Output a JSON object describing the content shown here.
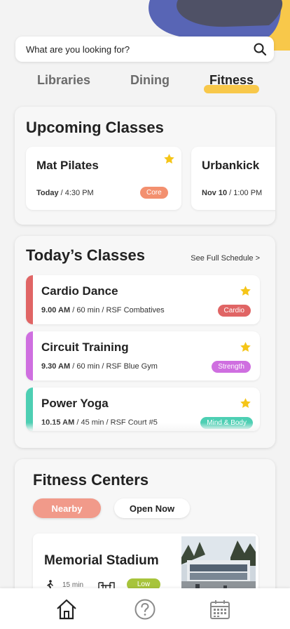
{
  "colors": {
    "accent": "#f8c84a",
    "blob_blue": "#5865b5",
    "blob_gray": "#4f5166",
    "core": "#f3906f",
    "cardio": "#e06565",
    "strength": "#cf6fe0",
    "mind_body": "#4dcfb3",
    "nearby": "#f19a8a",
    "low": "#a7c43b",
    "star": "#f5c518"
  },
  "search": {
    "placeholder": "What are you looking for?",
    "icon": "search-icon"
  },
  "tabs": [
    {
      "label": "Libraries",
      "active": false
    },
    {
      "label": "Dining",
      "active": false
    },
    {
      "label": "Fitness",
      "active": true
    }
  ],
  "upcoming": {
    "title": "Upcoming Classes",
    "items": [
      {
        "name": "Mat Pilates",
        "day": "Today",
        "time": " / 4:30 PM",
        "tag": "Core",
        "starred": true
      },
      {
        "name": "Urbankick",
        "day": "Nov 10",
        "time": " / 1:00 PM"
      }
    ]
  },
  "today": {
    "title": "Today’s Classes",
    "see_full": "See Full Schedule  >",
    "items": [
      {
        "name": "Cardio Dance",
        "time": "9.00 AM",
        "meta": " / 60 min / RSF Combatives",
        "tag": "Cardio",
        "starred": true
      },
      {
        "name": "Circuit Training",
        "time": "9.30 AM",
        "meta": " / 60 min / RSF Blue Gym",
        "tag": "Strength",
        "starred": true
      },
      {
        "name": "Power Yoga",
        "time": "10.15 AM",
        "meta": " / 45 min / RSF Court #5",
        "tag": "Mind & Body",
        "starred": true
      }
    ]
  },
  "centers": {
    "title": "Fitness Centers",
    "filters": [
      {
        "label": "Nearby",
        "active": true
      },
      {
        "label": "Open Now",
        "active": false
      }
    ],
    "items": [
      {
        "name": "Memorial Stadium",
        "walk": "15 min",
        "crowd": "Low"
      }
    ]
  },
  "nav": [
    {
      "icon": "home-icon"
    },
    {
      "icon": "help-icon"
    },
    {
      "icon": "calendar-icon"
    }
  ]
}
